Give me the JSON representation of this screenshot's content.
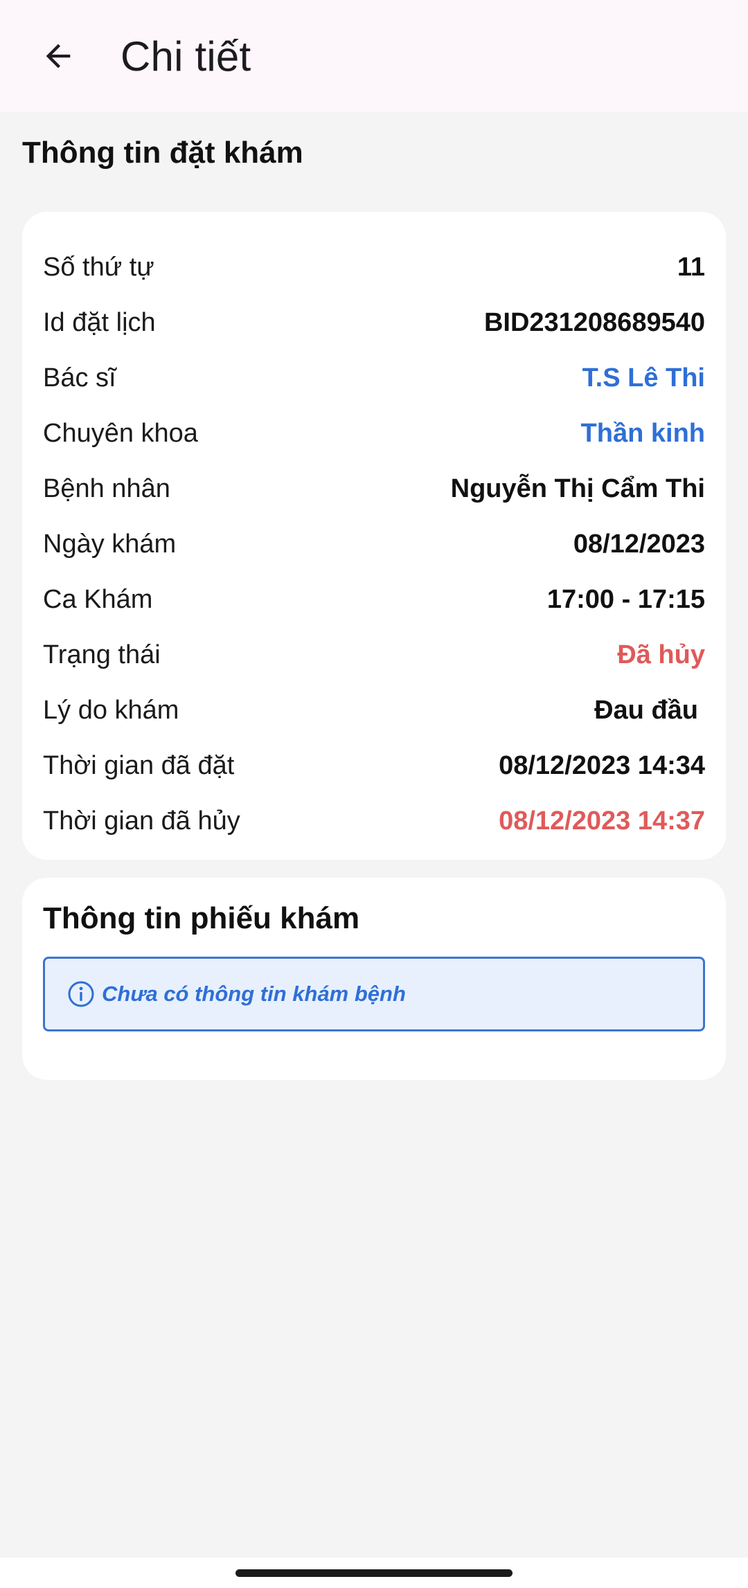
{
  "header": {
    "title": "Chi tiết",
    "back_icon": "arrow-left-icon"
  },
  "booking": {
    "section_title": "Thông tin đặt khám",
    "rows": [
      {
        "label": "Số thứ tự",
        "value": "11"
      },
      {
        "label": "Id đặt lịch",
        "value": "BID231208689540"
      },
      {
        "label": "Bác sĩ",
        "value": "T.S Lê Thi"
      },
      {
        "label": "Chuyên khoa",
        "value": "Thần kinh"
      },
      {
        "label": "Bệnh nhân",
        "value": "Nguyễn Thị Cẩm Thi"
      },
      {
        "label": "Ngày khám",
        "value": "08/12/2023"
      },
      {
        "label": "Ca Khám",
        "value": "17:00 - 17:15"
      },
      {
        "label": "Trạng thái",
        "value": "Đã hủy"
      },
      {
        "label": "Lý do khám",
        "value": "Đau đầu"
      },
      {
        "label": "Thời gian đã đặt",
        "value": "08/12/2023 14:34"
      },
      {
        "label": "Thời gian đã hủy",
        "value": "08/12/2023 14:37"
      }
    ]
  },
  "ticket": {
    "title": "Thông tin phiếu khám",
    "notice_icon": "info-icon",
    "notice_text": "Chưa có thông tin khám bệnh"
  },
  "colors": {
    "accent_blue": "#2f6fd6",
    "status_red": "#e05a5a",
    "header_bg": "#fdf6fb",
    "page_bg": "#f4f4f5"
  }
}
